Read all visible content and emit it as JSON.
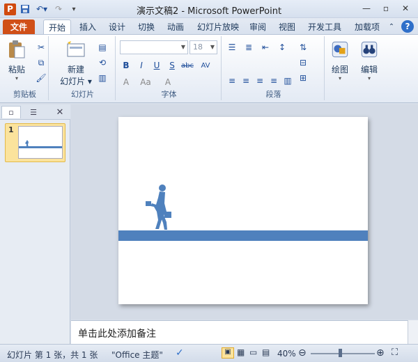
{
  "window": {
    "title": "演示文稿2 - Microsoft PowerPoint",
    "app_icon_letter": "P"
  },
  "tabs": {
    "file": "文件",
    "items": [
      "开始",
      "插入",
      "设计",
      "切换",
      "动画",
      "幻灯片放映",
      "审阅",
      "视图",
      "开发工具",
      "加载项"
    ],
    "active_index": 0
  },
  "ribbon": {
    "clipboard": {
      "paste": "粘贴",
      "group": "剪贴板"
    },
    "slides": {
      "new_slide_line1": "新建",
      "new_slide_line2": "幻灯片",
      "group": "幻灯片"
    },
    "font": {
      "size": "18",
      "group": "字体",
      "buttons": [
        "B",
        "I",
        "U",
        "S",
        "abc",
        "AV",
        "A",
        "Aa",
        "A"
      ]
    },
    "paragraph": {
      "group": "段落"
    },
    "drawing": {
      "label": "绘图"
    },
    "editing": {
      "label": "编辑"
    }
  },
  "slide_pane": {
    "slide_number": "1"
  },
  "notes": {
    "placeholder": "单击此处添加备注"
  },
  "status": {
    "slide_info": "幻灯片 第 1 张，共 1 张",
    "theme": "\"Office 主题\"",
    "zoom": "40%"
  },
  "colors": {
    "accent_bar": "#4f81bd",
    "file_tab": "#d04f17",
    "thumb_highlight": "#fbe39c"
  }
}
